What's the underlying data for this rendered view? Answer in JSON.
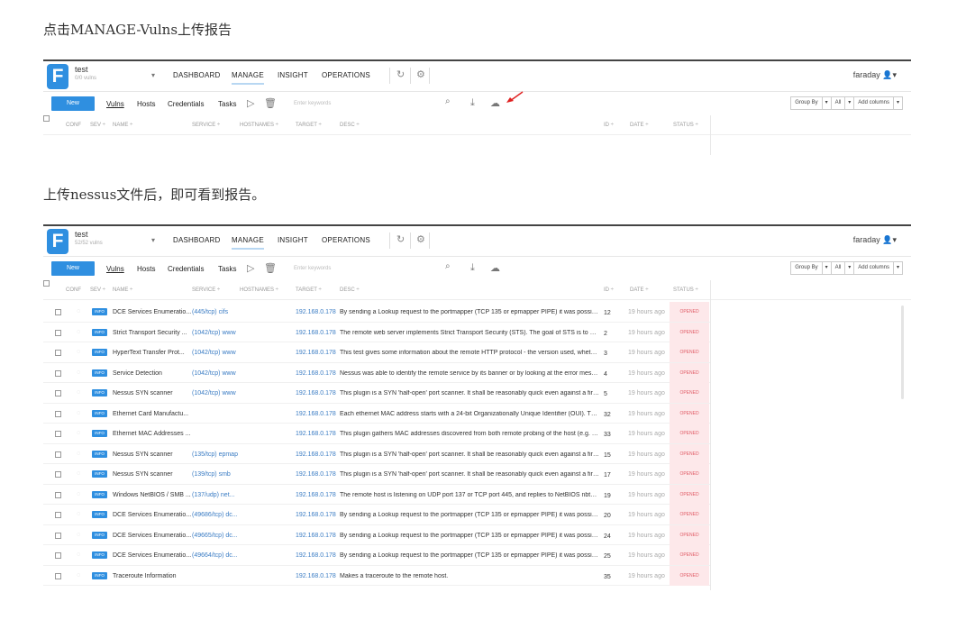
{
  "captions": {
    "first": "点击MANAGE-Vulns上传报告",
    "second": "上传nessus文件后，即可看到报告。"
  },
  "accent_color": "#2f8fe0",
  "status_color": "#e05a65",
  "logo_letter": "F",
  "header": {
    "workspace": "test",
    "nav": [
      "DASHBOARD",
      "MANAGE",
      "INSIGHT",
      "OPERATIONS"
    ],
    "user": "faraday",
    "icons": [
      "refresh-icon",
      "gear-icon",
      "user-icon"
    ]
  },
  "screenshot1": {
    "vuln_count": "0/0 vulns"
  },
  "screenshot2": {
    "vuln_count": "52/52 vulns"
  },
  "toolbar": {
    "new_label": "New",
    "links": [
      "Vulns",
      "Hosts",
      "Credentials",
      "Tasks"
    ],
    "search_placeholder": "Enter keywords",
    "group_by": "Group By",
    "all": "All",
    "add_columns": "Add columns",
    "dropdown_glyph": "▾"
  },
  "columns": {
    "conf": "CONF",
    "sev": "SEV",
    "name": "NAME",
    "service": "SERVICE",
    "hostnames": "HOSTNAMES",
    "target": "TARGET",
    "desc": "DESC",
    "id": "ID",
    "date": "DATE",
    "status": "STATUS"
  },
  "rows": [
    {
      "sev": "INFO",
      "name": "DCE Services Enumeratio...",
      "service": "(445/tcp) cifs",
      "target": "192.168.0.178",
      "desc": "By sending a Lookup request to the portmapper (TCP 135 or epmapper PIPE) it was possible to ...",
      "id": "12",
      "date": "19 hours ago",
      "status": "OPENED"
    },
    {
      "sev": "INFO",
      "name": "Strict Transport Security ...",
      "service": "(1042/tcp) www",
      "target": "192.168.0.178",
      "desc": "The remote web server implements Strict Transport Security (STS). The goal of STS is to make su...",
      "id": "2",
      "date": "19 hours ago",
      "status": "OPENED"
    },
    {
      "sev": "INFO",
      "name": "HyperText Transfer Prot...",
      "service": "(1042/tcp) www",
      "target": "192.168.0.178",
      "desc": "This test gives some information about the remote HTTP protocol - the version used, whether H...",
      "id": "3",
      "date": "19 hours ago",
      "status": "OPENED"
    },
    {
      "sev": "INFO",
      "name": "Service Detection",
      "service": "(1042/tcp) www",
      "target": "192.168.0.178",
      "desc": "Nessus was able to identify the remote service by its banner or by looking at the error message ...",
      "id": "4",
      "date": "19 hours ago",
      "status": "OPENED"
    },
    {
      "sev": "INFO",
      "name": "Nessus SYN scanner",
      "service": "(1042/tcp) www",
      "target": "192.168.0.178",
      "desc": "This plugin is a SYN 'half-open' port scanner.  It shall be reasonably quick even against a firewall...",
      "id": "5",
      "date": "19 hours ago",
      "status": "OPENED"
    },
    {
      "sev": "INFO",
      "name": "Ethernet Card Manufactu...",
      "service": "",
      "target": "192.168.0.178",
      "desc": "Each ethernet MAC address starts with a 24-bit Organizationally Unique Identifier (OUI). These ...",
      "id": "32",
      "date": "19 hours ago",
      "status": "OPENED"
    },
    {
      "sev": "INFO",
      "name": "Ethernet MAC Addresses ...",
      "service": "",
      "target": "192.168.0.178",
      "desc": "This plugin gathers MAC addresses discovered from both remote probing of the host (e.g. SNM...",
      "id": "33",
      "date": "19 hours ago",
      "status": "OPENED"
    },
    {
      "sev": "INFO",
      "name": "Nessus SYN scanner",
      "service": "(135/tcp) epmap",
      "target": "192.168.0.178",
      "desc": "This plugin is a SYN 'half-open' port scanner.  It shall be reasonably quick even against a firewall...",
      "id": "15",
      "date": "19 hours ago",
      "status": "OPENED"
    },
    {
      "sev": "INFO",
      "name": "Nessus SYN scanner",
      "service": "(139/tcp) smb",
      "target": "192.168.0.178",
      "desc": "This plugin is a SYN 'half-open' port scanner.  It shall be reasonably quick even against a firewall...",
      "id": "17",
      "date": "19 hours ago",
      "status": "OPENED"
    },
    {
      "sev": "INFO",
      "name": "Windows NetBIOS / SMB ...",
      "service": "(137/udp) net...",
      "target": "192.168.0.178",
      "desc": "The remote host is listening on UDP port 137 or TCP port 445, and replies to NetBIOS nbtscan o...",
      "id": "19",
      "date": "19 hours ago",
      "status": "OPENED"
    },
    {
      "sev": "INFO",
      "name": "DCE Services Enumeratio...",
      "service": "(49686/tcp) dc...",
      "target": "192.168.0.178",
      "desc": "By sending a Lookup request to the portmapper (TCP 135 or epmapper PIPE) it was possible to ...",
      "id": "20",
      "date": "19 hours ago",
      "status": "OPENED"
    },
    {
      "sev": "INFO",
      "name": "DCE Services Enumeratio...",
      "service": "(49665/tcp) dc...",
      "target": "192.168.0.178",
      "desc": "By sending a Lookup request to the portmapper (TCP 135 or epmapper PIPE) it was possible to ...",
      "id": "24",
      "date": "19 hours ago",
      "status": "OPENED"
    },
    {
      "sev": "INFO",
      "name": "DCE Services Enumeratio...",
      "service": "(49664/tcp) dc...",
      "target": "192.168.0.178",
      "desc": "By sending a Lookup request to the portmapper (TCP 135 or epmapper PIPE) it was possible to ...",
      "id": "25",
      "date": "19 hours ago",
      "status": "OPENED"
    },
    {
      "sev": "INFO",
      "name": "Traceroute Information",
      "service": "",
      "target": "192.168.0.178",
      "desc": "Makes a traceroute to the remote host.",
      "id": "35",
      "date": "19 hours ago",
      "status": "OPENED"
    }
  ]
}
